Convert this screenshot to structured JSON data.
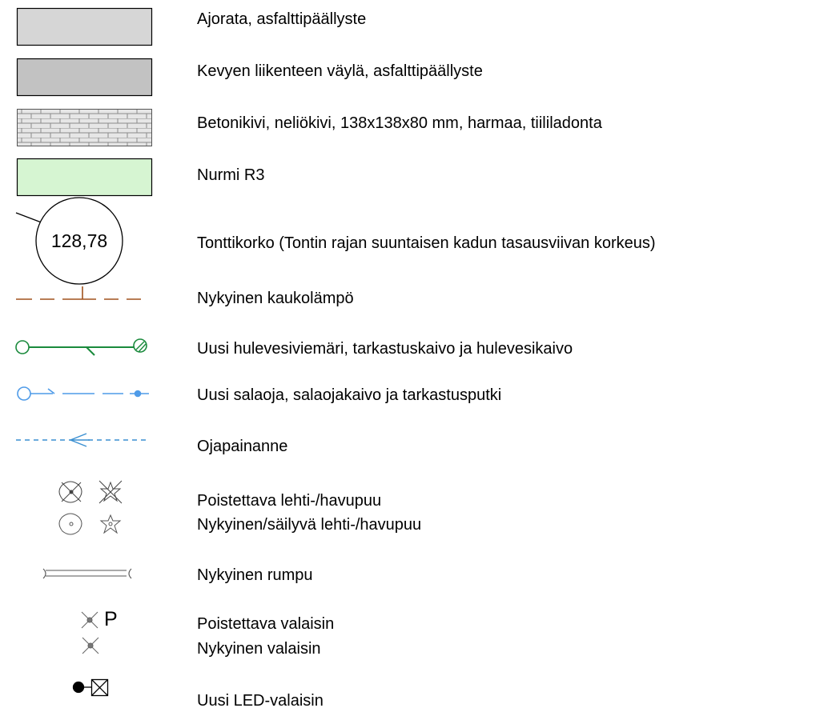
{
  "legend": {
    "items": [
      {
        "key": "road-asphalt",
        "label": "Ajorata, asfalttipäällyste",
        "fill": "#d6d6d6"
      },
      {
        "key": "light-traffic-asphalt",
        "label": "Kevyen liikenteen väylä, asfalttipäällyste",
        "fill": "#c2c2c2"
      },
      {
        "key": "concrete-paver",
        "label": "Betonikivi, neliökivi, 138x138x80 mm, harmaa, tiililadonta",
        "fill": "#e0e0e0"
      },
      {
        "key": "lawn",
        "label": "Nurmi R3",
        "fill": "#d6f5d2"
      },
      {
        "key": "plot-elevation",
        "label": "Tonttikorko (Tontin rajan suuntaisen kadun tasausviivan korkeus)",
        "value": "128,78"
      },
      {
        "key": "district-heating",
        "label": "Nykyinen kaukolämpö",
        "color": "#a0521d"
      },
      {
        "key": "storm-sewer",
        "label": "Uusi hulevesiviemäri, tarkastuskaivo ja hulevesikaivo",
        "color": "#1a8a3c"
      },
      {
        "key": "drain",
        "label": "Uusi salaoja, salaojakaivo ja tarkastusputki",
        "color": "#4f9be8"
      },
      {
        "key": "ditch",
        "label": "Ojapainanne",
        "color": "#3a8fd1"
      },
      {
        "key": "trees",
        "labels": [
          "Poistettava lehti-/havupuu",
          "Nykyinen/säilyvä lehti-/havupuu"
        ]
      },
      {
        "key": "culvert",
        "label": "Nykyinen rumpu"
      },
      {
        "key": "lights",
        "labels": [
          "Poistettava valaisin",
          "Nykyinen valaisin"
        ],
        "marker": "P"
      },
      {
        "key": "led-light",
        "label": "Uusi LED-valaisin"
      }
    ]
  }
}
